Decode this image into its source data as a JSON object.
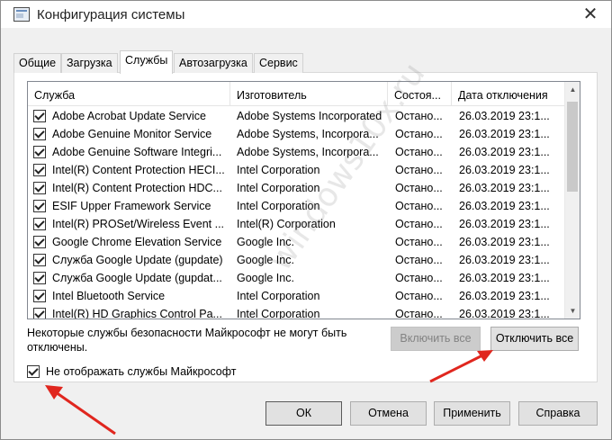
{
  "window": {
    "title": "Конфигурация системы",
    "close_glyph": "✕"
  },
  "tabs": [
    {
      "label": "Общие"
    },
    {
      "label": "Загрузка"
    },
    {
      "label": "Службы"
    },
    {
      "label": "Автозагрузка"
    },
    {
      "label": "Сервис"
    }
  ],
  "active_tab": "Службы",
  "table": {
    "columns": [
      "Служба",
      "Изготовитель",
      "Состоя...",
      "Дата отключения"
    ],
    "rows": [
      {
        "service": "Adobe Acrobat Update Service",
        "vendor": "Adobe Systems Incorporated",
        "status": "Остано...",
        "date": "26.03.2019 23:1...",
        "checked": true
      },
      {
        "service": "Adobe Genuine Monitor Service",
        "vendor": "Adobe Systems, Incorpora...",
        "status": "Остано...",
        "date": "26.03.2019 23:1...",
        "checked": true
      },
      {
        "service": "Adobe Genuine Software Integri...",
        "vendor": "Adobe Systems, Incorpora...",
        "status": "Остано...",
        "date": "26.03.2019 23:1...",
        "checked": true
      },
      {
        "service": "Intel(R) Content Protection HECI...",
        "vendor": "Intel Corporation",
        "status": "Остано...",
        "date": "26.03.2019 23:1...",
        "checked": true
      },
      {
        "service": "Intel(R) Content Protection HDC...",
        "vendor": "Intel Corporation",
        "status": "Остано...",
        "date": "26.03.2019 23:1...",
        "checked": true
      },
      {
        "service": "ESIF Upper Framework Service",
        "vendor": "Intel Corporation",
        "status": "Остано...",
        "date": "26.03.2019 23:1...",
        "checked": true
      },
      {
        "service": "Intel(R) PROSet/Wireless Event ...",
        "vendor": "Intel(R) Corporation",
        "status": "Остано...",
        "date": "26.03.2019 23:1...",
        "checked": true
      },
      {
        "service": "Google Chrome Elevation Service",
        "vendor": "Google Inc.",
        "status": "Остано...",
        "date": "26.03.2019 23:1...",
        "checked": true
      },
      {
        "service": "Служба Google Update (gupdate)",
        "vendor": "Google Inc.",
        "status": "Остано...",
        "date": "26.03.2019 23:1...",
        "checked": true
      },
      {
        "service": "Служба Google Update (gupdat...",
        "vendor": "Google Inc.",
        "status": "Остано...",
        "date": "26.03.2019 23:1...",
        "checked": true
      },
      {
        "service": "Intel Bluetooth Service",
        "vendor": "Intel Corporation",
        "status": "Остано...",
        "date": "26.03.2019 23:1...",
        "checked": true
      },
      {
        "service": "Intel(R) HD Graphics Control Pa...",
        "vendor": "Intel Corporation",
        "status": "Остано...",
        "date": "26.03.2019 23:1...",
        "checked": true
      }
    ]
  },
  "note": "Некоторые службы безопасности Майкрософт не могут быть отключены.",
  "buttons": {
    "enable_all": "Включить все",
    "disable_all": "Отключить все",
    "ok": "ОК",
    "cancel": "Отмена",
    "apply": "Применить",
    "help": "Справка"
  },
  "hide_ms": {
    "label": "Не отображать службы Майкрософт",
    "checked": true
  },
  "watermark": "windows10x.ru",
  "colors": {
    "arrow": "#e0261e",
    "accent": "#0078d7"
  }
}
